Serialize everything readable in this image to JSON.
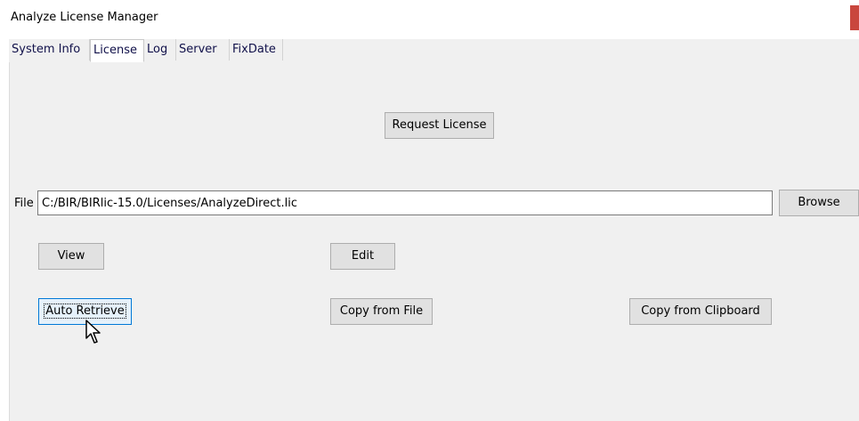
{
  "window": {
    "title": "Analyze License Manager"
  },
  "tabs": [
    "System Info",
    "License",
    "Log",
    "Server",
    "FixDate"
  ],
  "license_panel": {
    "request_label": "Request License",
    "file_label": "File",
    "file_path": "C:/BIR/BIRlic-15.0/Licenses/AnalyzeDirect.lic",
    "browse_label": "Browse",
    "view_label": "View",
    "edit_label": "Edit",
    "auto_retrieve_label": "Auto Retrieve",
    "copy_file_label": "Copy from File",
    "copy_clipboard_label": "Copy from Clipboard"
  }
}
